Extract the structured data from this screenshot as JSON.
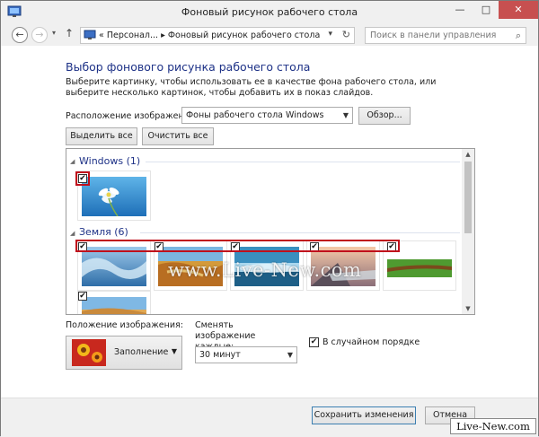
{
  "window": {
    "title": "Фоновый рисунок рабочего стола",
    "minimize": "—",
    "maximize": "□",
    "close": "✕"
  },
  "nav": {
    "back": "←",
    "forward": "→",
    "history": "▾",
    "up": "↑",
    "breadcrumb": "«  Персонал...  ▸  Фоновый рисунок рабочего стола",
    "dropdown": "▾",
    "refresh": "↻",
    "search_placeholder": "Поиск в панели управления",
    "search_icon": "⌕"
  },
  "page": {
    "heading": "Выбор фонового рисунка рабочего стола",
    "description": "Выберите картинку, чтобы использовать ее в качестве фона рабочего стола, или выберите несколько картинок, чтобы добавить их в показ слайдов.",
    "location_label": "Расположение изображения:",
    "location_value": "Фоны рабочего стола Windows",
    "browse_button": "Обзор...",
    "select_all_button": "Выделить все",
    "clear_all_button": "Очистить все"
  },
  "gallery": {
    "groups": [
      {
        "title": "Windows (1)",
        "collapse_icon": "◢"
      },
      {
        "title": "Земля (6)",
        "collapse_icon": "◢"
      }
    ],
    "check_mark": "✔"
  },
  "watermark": "www.Live-New.com",
  "options": {
    "position_label": "Положение изображения:",
    "position_value": "Заполнение",
    "change_label": "Сменять изображение каждые:",
    "change_value": "30 минут",
    "shuffle_label": "В случайном порядке",
    "shuffle_checked": true
  },
  "footer": {
    "save_button": "Сохранить изменения",
    "cancel_button": "Отмена"
  },
  "site_badge": "Live-New.com",
  "colors": {
    "heading": "#1e3287",
    "selection_outline": "#c0101c",
    "close_button": "#c75050"
  }
}
